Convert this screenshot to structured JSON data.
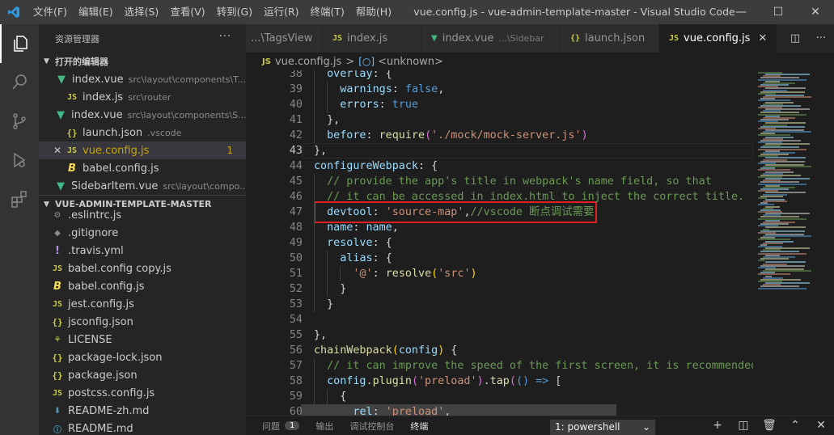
{
  "window": {
    "title": "vue.config.js - vue-admin-template-master - Visual Studio Code",
    "menu": [
      "文件(F)",
      "编辑(E)",
      "选择(S)",
      "查看(V)",
      "转到(G)",
      "运行(R)",
      "终端(T)",
      "帮助(H)"
    ]
  },
  "sidebar": {
    "title": "资源管理器",
    "open_editors_title": "打开的编辑器",
    "open_editors": [
      {
        "icon": "vue-icon",
        "name": "index.vue",
        "desc": "src\\layout\\components\\T..."
      },
      {
        "icon": "js-icon",
        "name": "index.js",
        "desc": "src\\router"
      },
      {
        "icon": "vue-icon",
        "name": "index.vue",
        "desc": "src\\layout\\components\\S..."
      },
      {
        "icon": "json-icon",
        "name": "launch.json",
        "desc": ".vscode"
      },
      {
        "icon": "js-icon",
        "name": "vue.config.js",
        "desc": "",
        "badge": "1",
        "selected": true
      },
      {
        "icon": "babel-icon",
        "name": "babel.config.js",
        "desc": ""
      },
      {
        "icon": "vue-icon",
        "name": "SidebarItem.vue",
        "desc": "src\\layout\\compo..."
      }
    ],
    "project_title": "VUE-ADMIN-TEMPLATE-MASTER",
    "files": [
      {
        "icon": "gear-icon",
        "name": ".eslintrc.js"
      },
      {
        "icon": "git-icon",
        "name": ".gitignore"
      },
      {
        "icon": "travis-icon",
        "name": ".travis.yml"
      },
      {
        "icon": "js-icon",
        "name": "babel.config copy.js"
      },
      {
        "icon": "babel-icon",
        "name": "babel.config.js"
      },
      {
        "icon": "js-icon",
        "name": "jest.config.js"
      },
      {
        "icon": "json-icon",
        "name": "jsconfig.json"
      },
      {
        "icon": "license-icon",
        "name": "LICENSE"
      },
      {
        "icon": "json-icon",
        "name": "package-lock.json"
      },
      {
        "icon": "json-icon",
        "name": "package.json"
      },
      {
        "icon": "js-icon",
        "name": "postcss.config.js"
      },
      {
        "icon": "download-icon",
        "name": "README-zh.md"
      },
      {
        "icon": "info-icon",
        "name": "README.md"
      }
    ]
  },
  "tabs": [
    {
      "icon": "",
      "name": "...\\TagsView",
      "desc": ""
    },
    {
      "icon": "js-icon",
      "name": "index.js",
      "desc": ""
    },
    {
      "icon": "vue-icon",
      "name": "index.vue",
      "desc": "...\\Sidebar"
    },
    {
      "icon": "json-icon",
      "name": "launch.json",
      "desc": ""
    },
    {
      "icon": "js-icon",
      "name": "vue.config.js",
      "desc": "",
      "active": true
    }
  ],
  "breadcrumb": {
    "file": "vue.config.js",
    "symbol": "<unknown>"
  },
  "editor": {
    "current_line": 43,
    "highlighted_line": 47,
    "lines": [
      {
        "n": "38",
        "indent": 1,
        "tokens": [
          [
            "k",
            "overlay"
          ],
          [
            "p",
            ": {"
          ]
        ]
      },
      {
        "n": "39",
        "indent": 2,
        "tokens": [
          [
            "k",
            "warnings"
          ],
          [
            "p",
            ": "
          ],
          [
            "b",
            "false"
          ],
          [
            "p",
            ","
          ]
        ]
      },
      {
        "n": "40",
        "indent": 2,
        "tokens": [
          [
            "k",
            "errors"
          ],
          [
            "p",
            ": "
          ],
          [
            "b",
            "true"
          ]
        ]
      },
      {
        "n": "41",
        "indent": 1,
        "tokens": [
          [
            "p",
            "},"
          ]
        ]
      },
      {
        "n": "42",
        "indent": 1,
        "tokens": [
          [
            "k",
            "before"
          ],
          [
            "p",
            ": "
          ],
          [
            "f",
            "require"
          ],
          [
            "m",
            "("
          ],
          [
            "s",
            "'./mock/mock-server.js'"
          ],
          [
            "m",
            ")"
          ]
        ]
      },
      {
        "n": "43",
        "indent": 0,
        "tokens": [
          [
            "p",
            "},"
          ]
        ]
      },
      {
        "n": "44",
        "indent": 0,
        "tokens": [
          [
            "k",
            "configureWebpack"
          ],
          [
            "p",
            ": {"
          ]
        ]
      },
      {
        "n": "45",
        "indent": 1,
        "tokens": [
          [
            "c",
            "// provide the app's title in webpack's name field, so that"
          ]
        ]
      },
      {
        "n": "46",
        "indent": 1,
        "tokens": [
          [
            "c",
            "// it can be accessed in index.html to inject the correct title."
          ]
        ]
      },
      {
        "n": "47",
        "indent": 1,
        "tokens": [
          [
            "k",
            "devtool"
          ],
          [
            "p",
            ": "
          ],
          [
            "s",
            "'source-map'"
          ],
          [
            "p",
            ","
          ],
          [
            "c",
            "//vscode 断点调试需要"
          ]
        ]
      },
      {
        "n": "48",
        "indent": 1,
        "tokens": [
          [
            "k",
            "name"
          ],
          [
            "p",
            ": "
          ],
          [
            "k",
            "name"
          ],
          [
            "p",
            ","
          ]
        ]
      },
      {
        "n": "49",
        "indent": 1,
        "tokens": [
          [
            "k",
            "resolve"
          ],
          [
            "p",
            ": {"
          ]
        ]
      },
      {
        "n": "50",
        "indent": 2,
        "tokens": [
          [
            "k",
            "alias"
          ],
          [
            "p",
            ": {"
          ]
        ]
      },
      {
        "n": "51",
        "indent": 3,
        "tokens": [
          [
            "s",
            "'@'"
          ],
          [
            "p",
            ": "
          ],
          [
            "f",
            "resolve"
          ],
          [
            "y",
            "("
          ],
          [
            "s",
            "'src'"
          ],
          [
            "y",
            ")"
          ]
        ]
      },
      {
        "n": "52",
        "indent": 2,
        "tokens": [
          [
            "p",
            "}"
          ]
        ]
      },
      {
        "n": "53",
        "indent": 1,
        "tokens": [
          [
            "p",
            "}"
          ]
        ]
      },
      {
        "n": "54",
        "indent": 0,
        "tokens": []
      },
      {
        "n": "55",
        "indent": 0,
        "tokens": [
          [
            "p",
            "},"
          ]
        ]
      },
      {
        "n": "56",
        "indent": 0,
        "tokens": [
          [
            "f",
            "chainWebpack"
          ],
          [
            "y",
            "("
          ],
          [
            "k",
            "config"
          ],
          [
            "y",
            ")"
          ],
          [
            "p",
            " {"
          ]
        ]
      },
      {
        "n": "57",
        "indent": 1,
        "tokens": [
          [
            "c",
            "// it can improve the speed of the first screen, it is recommended to"
          ]
        ]
      },
      {
        "n": "58",
        "indent": 1,
        "tokens": [
          [
            "k",
            "config"
          ],
          [
            "p",
            "."
          ],
          [
            "f",
            "plugin"
          ],
          [
            "m",
            "("
          ],
          [
            "s",
            "'preload'"
          ],
          [
            "m",
            ")"
          ],
          [
            "p",
            "."
          ],
          [
            "f",
            "tap"
          ],
          [
            "m",
            "("
          ],
          [
            "b",
            "()"
          ],
          [
            "p",
            " "
          ],
          [
            "b",
            "=>"
          ],
          [
            "p",
            " ["
          ]
        ]
      },
      {
        "n": "59",
        "indent": 2,
        "tokens": [
          [
            "p",
            "{"
          ]
        ]
      },
      {
        "n": "60",
        "indent": 3,
        "tokens": [
          [
            "k",
            "rel"
          ],
          [
            "p",
            ": "
          ],
          [
            "s",
            "'preload'"
          ],
          [
            "p",
            ","
          ]
        ]
      }
    ]
  },
  "panel": {
    "tabs": [
      "问题",
      "输出",
      "调试控制台",
      "终端"
    ],
    "problems_count": "1",
    "active_tab": 3,
    "terminal_select": "1: powershell"
  },
  "colors": {
    "accent": "#007acc",
    "highlight_box": "#e02020"
  }
}
